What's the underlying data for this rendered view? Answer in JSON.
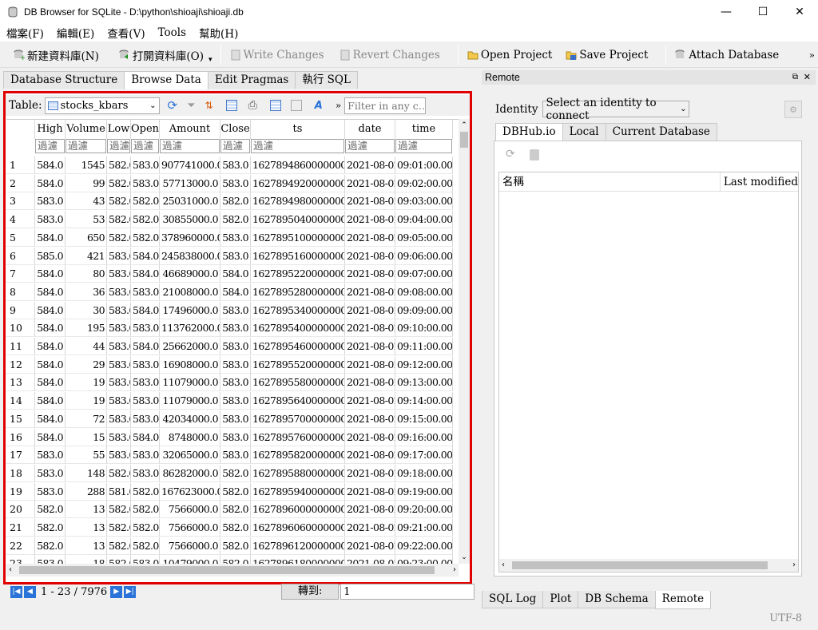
{
  "window": {
    "title": "DB Browser for SQLite - D:\\python\\shioaji\\shioaji.db",
    "minimize": "—",
    "maximize": "☐",
    "close": "✕"
  },
  "menu": [
    "檔案(F)",
    "編輯(E)",
    "查看(V)",
    "Tools",
    "幫助(H)"
  ],
  "toolbar": {
    "new_db": "新建資料庫(N)",
    "open_db": "打開資料庫(O)",
    "write_changes": "Write Changes",
    "revert_changes": "Revert Changes",
    "open_project": "Open Project",
    "save_project": "Save Project",
    "attach_db": "Attach Database",
    "more": "»"
  },
  "tabs": [
    "Database Structure",
    "Browse Data",
    "Edit Pragmas",
    "執行 SQL"
  ],
  "browse": {
    "table_label": "Table:",
    "table_name": "stocks_kbars",
    "filter_placeholder": "Filter in any c…",
    "more": "»",
    "columns": [
      "High",
      "Volume",
      "Low",
      "Open",
      "Amount",
      "Close",
      "ts",
      "date",
      "time"
    ],
    "filter_text": "過濾",
    "rows": [
      [
        "1",
        "584.0",
        "1545",
        "582.0",
        "583.0",
        "907741000.0",
        "583.0",
        "1627894860000000000",
        "2021-08-02",
        "09:01:00.0000"
      ],
      [
        "2",
        "584.0",
        "99",
        "582.0",
        "583.0",
        "57713000.0",
        "583.0",
        "1627894920000000000",
        "2021-08-02",
        "09:02:00.0000"
      ],
      [
        "3",
        "583.0",
        "43",
        "582.0",
        "582.0",
        "25031000.0",
        "582.0",
        "1627894980000000000",
        "2021-08-02",
        "09:03:00.0000"
      ],
      [
        "4",
        "583.0",
        "53",
        "582.0",
        "582.0",
        "30855000.0",
        "582.0",
        "1627895040000000000",
        "2021-08-02",
        "09:04:00.0000"
      ],
      [
        "5",
        "584.0",
        "650",
        "582.0",
        "582.0",
        "378960000.0",
        "583.0",
        "1627895100000000000",
        "2021-08-02",
        "09:05:00.0000"
      ],
      [
        "6",
        "585.0",
        "421",
        "583.0",
        "584.0",
        "245838000.0",
        "583.0",
        "1627895160000000000",
        "2021-08-02",
        "09:06:00.0000"
      ],
      [
        "7",
        "584.0",
        "80",
        "583.0",
        "584.0",
        "46689000.0",
        "584.0",
        "1627895220000000000",
        "2021-08-02",
        "09:07:00.0000"
      ],
      [
        "8",
        "584.0",
        "36",
        "583.0",
        "583.0",
        "21008000.0",
        "584.0",
        "1627895280000000000",
        "2021-08-02",
        "09:08:00.0000"
      ],
      [
        "9",
        "584.0",
        "30",
        "583.0",
        "584.0",
        "17496000.0",
        "583.0",
        "1627895340000000000",
        "2021-08-02",
        "09:09:00.0000"
      ],
      [
        "10",
        "584.0",
        "195",
        "583.0",
        "583.0",
        "113762000.0",
        "583.0",
        "1627895400000000000",
        "2021-08-02",
        "09:10:00.0000"
      ],
      [
        "11",
        "584.0",
        "44",
        "583.0",
        "584.0",
        "25662000.0",
        "583.0",
        "1627895460000000000",
        "2021-08-02",
        "09:11:00.0000"
      ],
      [
        "12",
        "584.0",
        "29",
        "583.0",
        "583.0",
        "16908000.0",
        "583.0",
        "1627895520000000000",
        "2021-08-02",
        "09:12:00.0000"
      ],
      [
        "13",
        "584.0",
        "19",
        "583.0",
        "583.0",
        "11079000.0",
        "583.0",
        "1627895580000000000",
        "2021-08-02",
        "09:13:00.0000"
      ],
      [
        "14",
        "584.0",
        "19",
        "583.0",
        "583.0",
        "11079000.0",
        "583.0",
        "1627895640000000000",
        "2021-08-02",
        "09:14:00.0000"
      ],
      [
        "15",
        "584.0",
        "72",
        "583.0",
        "583.0",
        "42034000.0",
        "583.0",
        "1627895700000000000",
        "2021-08-02",
        "09:15:00.0000"
      ],
      [
        "16",
        "584.0",
        "15",
        "583.0",
        "584.0",
        "8748000.0",
        "583.0",
        "1627895760000000000",
        "2021-08-02",
        "09:16:00.0000"
      ],
      [
        "17",
        "583.0",
        "55",
        "583.0",
        "583.0",
        "32065000.0",
        "583.0",
        "1627895820000000000",
        "2021-08-02",
        "09:17:00.0000"
      ],
      [
        "18",
        "583.0",
        "148",
        "582.0",
        "583.0",
        "86282000.0",
        "582.0",
        "1627895880000000000",
        "2021-08-02",
        "09:18:00.0000"
      ],
      [
        "19",
        "583.0",
        "288",
        "581.0",
        "582.0",
        "167623000.0",
        "582.0",
        "1627895940000000000",
        "2021-08-02",
        "09:19:00.0000"
      ],
      [
        "20",
        "582.0",
        "13",
        "582.0",
        "582.0",
        "7566000.0",
        "582.0",
        "1627896000000000000",
        "2021-08-02",
        "09:20:00.0000"
      ],
      [
        "21",
        "582.0",
        "13",
        "582.0",
        "582.0",
        "7566000.0",
        "582.0",
        "1627896060000000000",
        "2021-08-02",
        "09:21:00.0000"
      ],
      [
        "22",
        "582.0",
        "13",
        "582.0",
        "582.0",
        "7566000.0",
        "582.0",
        "1627896120000000000",
        "2021-08-02",
        "09:22:00.0000"
      ],
      [
        "23",
        "583.0",
        "18",
        "582.0",
        "583.0",
        "10479000.0",
        "582.0",
        "1627896180000000000",
        "2021-08-02",
        "09:23:00.0000"
      ]
    ],
    "record_range": "1 - 23 / 7976",
    "goto_label": "轉到:",
    "goto_value": "1"
  },
  "remote": {
    "title": "Remote",
    "identity_label": "Identity",
    "identity_value": "Select an identity to connect",
    "tabs": [
      "DBHub.io",
      "Local",
      "Current Database"
    ],
    "col_name": "名稱",
    "col_modified": "Last modified"
  },
  "bottom_tabs": [
    "SQL Log",
    "Plot",
    "DB Schema",
    "Remote"
  ],
  "status": {
    "encoding": "UTF-8"
  }
}
